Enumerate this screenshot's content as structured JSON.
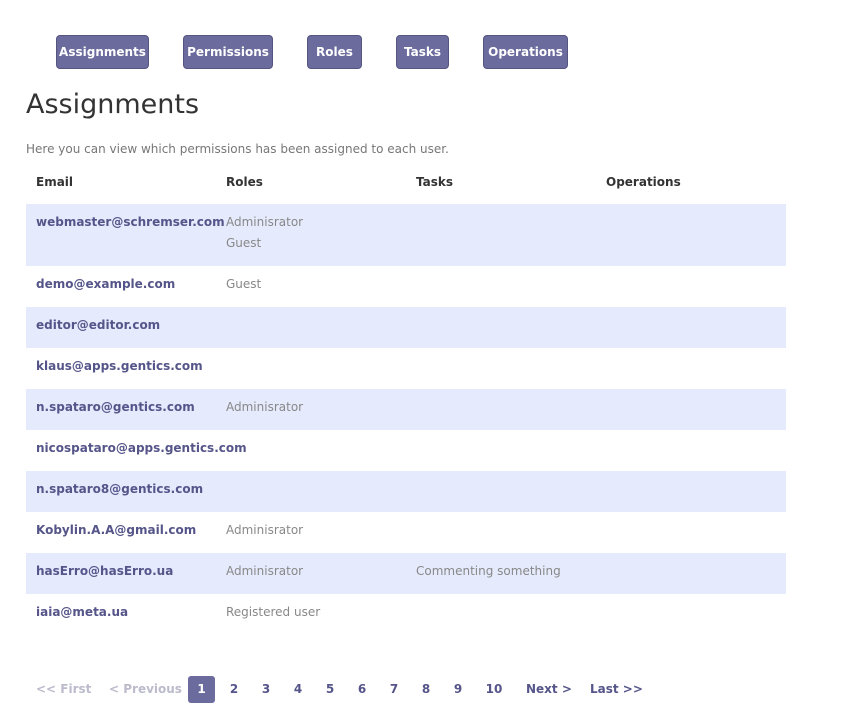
{
  "nav": {
    "assignments": "Assignments",
    "permissions": "Permissions",
    "roles": "Roles",
    "tasks": "Tasks",
    "operations": "Operations"
  },
  "page": {
    "title": "Assignments",
    "description": "Here you can view which permissions has been assigned to each user."
  },
  "table": {
    "headers": {
      "email": "Email",
      "roles": "Roles",
      "tasks": "Tasks",
      "operations": "Operations"
    },
    "rows": [
      {
        "email": "webmaster@schremser.com",
        "roles": [
          "Adminisrator",
          "Guest"
        ],
        "tasks": "",
        "operations": ""
      },
      {
        "email": "demo@example.com",
        "roles": [
          "Guest"
        ],
        "tasks": "",
        "operations": ""
      },
      {
        "email": "editor@editor.com",
        "roles": [],
        "tasks": "",
        "operations": ""
      },
      {
        "email": "klaus@apps.gentics.com",
        "roles": [],
        "tasks": "",
        "operations": ""
      },
      {
        "email": "n.spataro@gentics.com",
        "roles": [
          "Adminisrator"
        ],
        "tasks": "",
        "operations": ""
      },
      {
        "email": "nicospataro@apps.gentics.com",
        "roles": [],
        "tasks": "",
        "operations": ""
      },
      {
        "email": "n.spataro8@gentics.com",
        "roles": [],
        "tasks": "",
        "operations": ""
      },
      {
        "email": "Kobylin.A.A@gmail.com",
        "roles": [
          "Adminisrator"
        ],
        "tasks": "",
        "operations": ""
      },
      {
        "email": "hasErro@hasErro.ua",
        "roles": [
          "Adminisrator"
        ],
        "tasks": "Commenting something",
        "operations": ""
      },
      {
        "email": "iaia@meta.ua",
        "roles": [
          "Registered user"
        ],
        "tasks": "",
        "operations": ""
      }
    ]
  },
  "pager": {
    "first": "<< First",
    "previous": "< Previous",
    "pages": [
      "1",
      "2",
      "3",
      "4",
      "5",
      "6",
      "7",
      "8",
      "9",
      "10"
    ],
    "current": "1",
    "next": "Next >",
    "last": "Last >>"
  },
  "colors": {
    "accent": "#6b6b9e",
    "row_stripe": "#e5ebfd",
    "link": "#55558a"
  }
}
